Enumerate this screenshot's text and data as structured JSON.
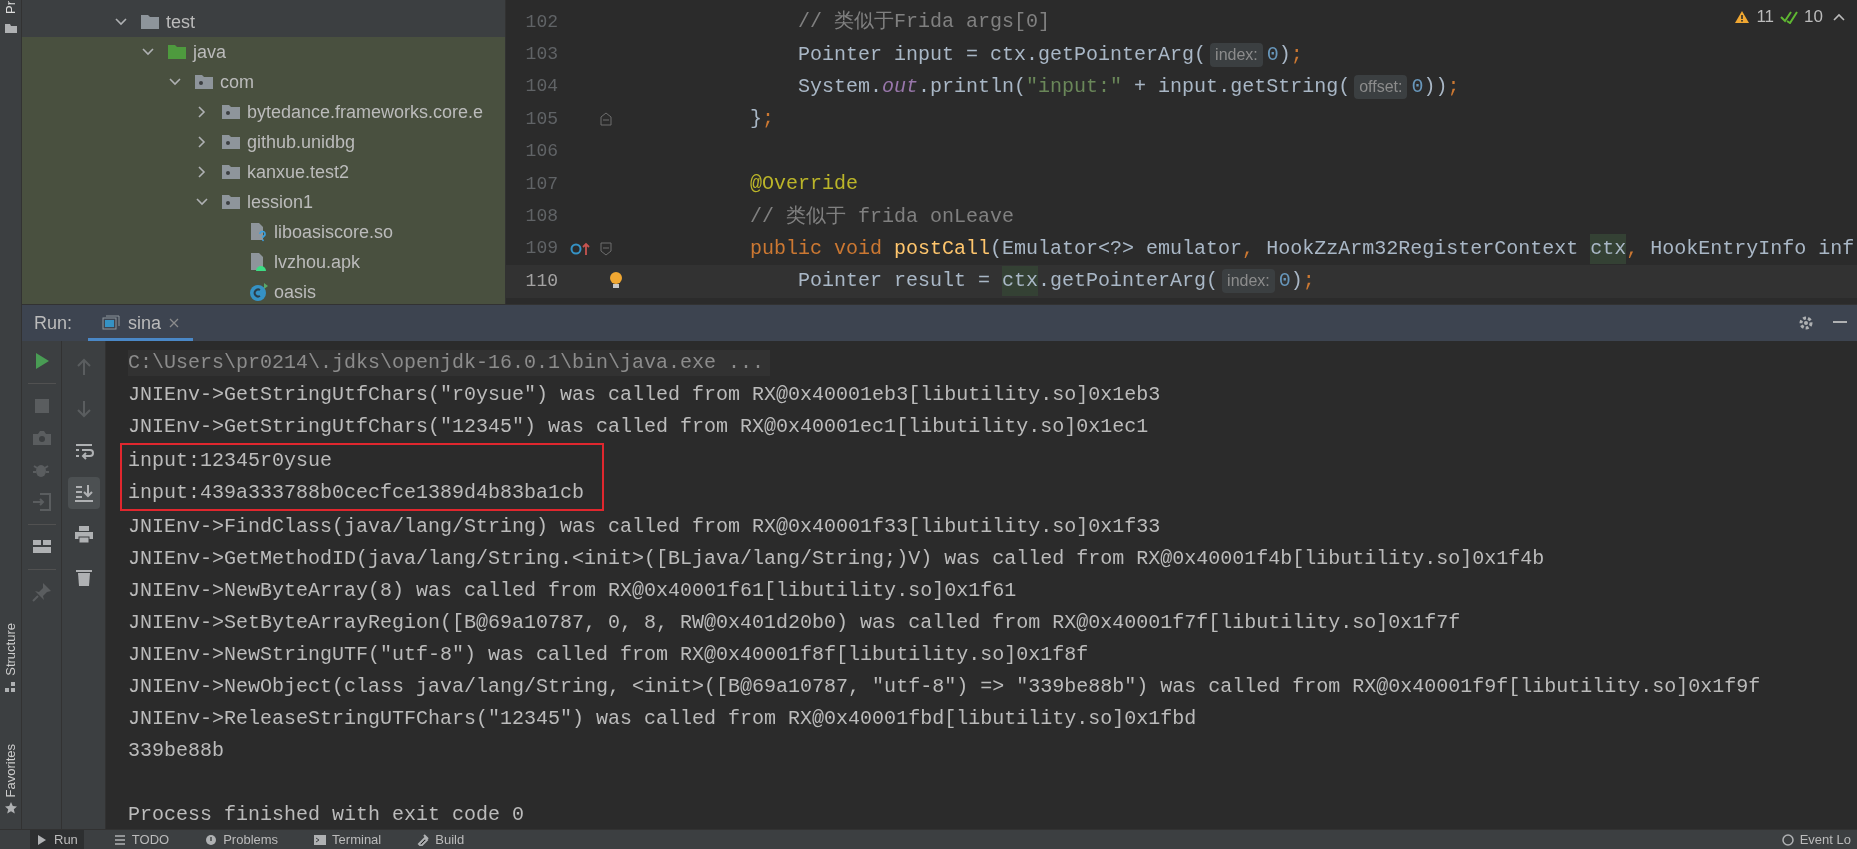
{
  "side_strip": {
    "top_label": "Pr",
    "labels": [
      "Structure",
      "Favorites"
    ]
  },
  "project_tree": [
    {
      "label": "test",
      "kind": "folder",
      "expanded": true,
      "children": [
        {
          "label": "java",
          "kind": "source-root",
          "expanded": true,
          "children": [
            {
              "label": "com",
              "kind": "package",
              "expanded": true,
              "children": [
                {
                  "label": "bytedance.frameworks.core.e",
                  "kind": "package",
                  "expanded": false
                },
                {
                  "label": "github.unidbg",
                  "kind": "package",
                  "expanded": false
                },
                {
                  "label": "kanxue.test2",
                  "kind": "package",
                  "expanded": false
                },
                {
                  "label": "lession1",
                  "kind": "package",
                  "expanded": true,
                  "children": [
                    {
                      "label": "liboasiscore.so",
                      "kind": "unknown-file"
                    },
                    {
                      "label": "lvzhou.apk",
                      "kind": "apk-file"
                    },
                    {
                      "label": "oasis",
                      "kind": "class"
                    }
                  ]
                }
              ]
            }
          ]
        }
      ]
    }
  ],
  "editor": {
    "warnings": "11",
    "checks": "10",
    "lines": [
      {
        "number": "102",
        "current": false,
        "kind": "plain",
        "tokens": [
          {
            "text": "            // 类似于Frida args[0]",
            "kind": "comment"
          }
        ]
      },
      {
        "number": "103",
        "current": false,
        "kind": "plain",
        "tokens": [
          {
            "text": "            Pointer input = ctx.getPointerArg(",
            "kind": "plain"
          },
          {
            "text": "index:",
            "kind": "hint"
          },
          {
            "text": "0",
            "kind": "number"
          },
          {
            "text": ")",
            "kind": "plain"
          },
          {
            "text": ";",
            "kind": "punct"
          }
        ]
      },
      {
        "number": "104",
        "current": false,
        "kind": "plain",
        "tokens": [
          {
            "text": "            System.",
            "kind": "plain"
          },
          {
            "text": "out",
            "kind": "field"
          },
          {
            "text": ".println(",
            "kind": "plain"
          },
          {
            "text": "\"input:\"",
            "kind": "string"
          },
          {
            "text": " + input.getString(",
            "kind": "plain"
          },
          {
            "text": "offset:",
            "kind": "hint"
          },
          {
            "text": "0",
            "kind": "number"
          },
          {
            "text": "))",
            "kind": "plain"
          },
          {
            "text": ";",
            "kind": "punct"
          }
        ]
      },
      {
        "number": "105",
        "current": false,
        "kind": "fold",
        "tokens": [
          {
            "text": "        }",
            "kind": "plain"
          },
          {
            "text": ";",
            "kind": "punct"
          }
        ]
      },
      {
        "number": "106",
        "current": false,
        "kind": "plain"
      },
      {
        "number": "107",
        "current": false,
        "kind": "plain",
        "tokens": [
          {
            "text": "        @Override",
            "kind": "annotation"
          }
        ]
      },
      {
        "number": "108",
        "current": false,
        "kind": "plain",
        "tokens": [
          {
            "text": "        // 类似于 frida onLeave",
            "kind": "comment"
          }
        ]
      },
      {
        "number": "109",
        "current": false,
        "kind": "override",
        "tokens": [
          {
            "text": "        public void ",
            "kind": "keyword"
          },
          {
            "text": "postCall",
            "kind": "method"
          },
          {
            "text": "(Emulator<?> emulator",
            "kind": "plain"
          },
          {
            "text": ", ",
            "kind": "punct"
          },
          {
            "text": "HookZzArm32RegisterContext ",
            "kind": "plain"
          },
          {
            "text": "ctx",
            "kind": "highlighted"
          },
          {
            "text": ", ",
            "kind": "punct"
          },
          {
            "text": "HookEntryInfo inf",
            "kind": "plain"
          }
        ]
      },
      {
        "number": "110",
        "current": true,
        "kind": "bulb",
        "tokens": [
          {
            "text": "            Pointer result = ",
            "kind": "plain"
          },
          {
            "text": "ctx",
            "kind": "highlighted"
          },
          {
            "text": ".getPointerArg(",
            "kind": "plain"
          },
          {
            "text": "index:",
            "kind": "hint"
          },
          {
            "text": "0",
            "kind": "number"
          },
          {
            "text": ")",
            "kind": "plain"
          },
          {
            "text": ";",
            "kind": "punct"
          }
        ]
      }
    ]
  },
  "run_panel": {
    "label": "Run:",
    "tabs": [
      {
        "label": "sina",
        "selected": true
      }
    ],
    "toolbar": [
      {
        "kind": "run",
        "enabled": true
      },
      {
        "kind": "stop",
        "enabled": false
      },
      {
        "kind": "camera",
        "enabled": false
      },
      {
        "kind": "bug",
        "enabled": false
      },
      {
        "kind": "exit",
        "enabled": false
      },
      {
        "kind": "layout",
        "enabled": true
      },
      {
        "kind": "pin",
        "enabled": false
      }
    ],
    "toolbar2": [
      {
        "kind": "up",
        "selected": false
      },
      {
        "kind": "down",
        "selected": false
      },
      {
        "kind": "wrap",
        "selected": false
      },
      {
        "kind": "scroll-end",
        "selected": true
      },
      {
        "kind": "print",
        "selected": false
      },
      {
        "kind": "trash",
        "selected": false
      }
    ],
    "console": [
      {
        "text": "C:\\Users\\pr0214\\.jdks\\openjdk-16.0.1\\bin\\java.exe ...",
        "kind": "command"
      },
      {
        "text": "JNIEnv->GetStringUtfChars(\"r0ysue\") was called from RX@0x40001eb3[libutility.so]0x1eb3",
        "kind": "output"
      },
      {
        "text": "JNIEnv->GetStringUtfChars(\"12345\") was called from RX@0x40001ec1[libutility.so]0x1ec1",
        "kind": "output"
      },
      {
        "kind": "outlined-group",
        "lines": [
          "input:12345r0ysue",
          "input:439a333788b0cecfce1389d4b83ba1cb"
        ]
      },
      {
        "text": "JNIEnv->FindClass(java/lang/String) was called from RX@0x40001f33[libutility.so]0x1f33",
        "kind": "output"
      },
      {
        "text": "JNIEnv->GetMethodID(java/lang/String.<init>([BLjava/lang/String;)V) was called from RX@0x40001f4b[libutility.so]0x1f4b",
        "kind": "output"
      },
      {
        "text": "JNIEnv->NewByteArray(8) was called from RX@0x40001f61[libutility.so]0x1f61",
        "kind": "output"
      },
      {
        "text": "JNIEnv->SetByteArrayRegion([B@69a10787, 0, 8, RW@0x401d20b0) was called from RX@0x40001f7f[libutility.so]0x1f7f",
        "kind": "output"
      },
      {
        "text": "JNIEnv->NewStringUTF(\"utf-8\") was called from RX@0x40001f8f[libutility.so]0x1f8f",
        "kind": "output"
      },
      {
        "text": "JNIEnv->NewObject(class java/lang/String, <init>([B@69a10787, \"utf-8\") => \"339be88b\") was called from RX@0x40001f9f[libutility.so]0x1f9f",
        "kind": "output"
      },
      {
        "text": "JNIEnv->ReleaseStringUTFChars(\"12345\") was called from RX@0x40001fbd[libutility.so]0x1fbd",
        "kind": "output"
      },
      {
        "text": "339be88b",
        "kind": "output"
      },
      {
        "text": "Process finished with exit code 0",
        "kind": "exit"
      }
    ]
  },
  "bottom_bar": [
    {
      "label": "Run",
      "kind": "run",
      "selected": true
    },
    {
      "label": "TODO",
      "kind": "todo",
      "selected": false
    },
    {
      "label": "Problems",
      "kind": "problems",
      "selected": false
    },
    {
      "label": "Terminal",
      "kind": "terminal",
      "selected": false
    },
    {
      "label": "Build",
      "kind": "build",
      "selected": false
    },
    {
      "label": "Event Lo",
      "kind": "event",
      "selected": false
    }
  ]
}
